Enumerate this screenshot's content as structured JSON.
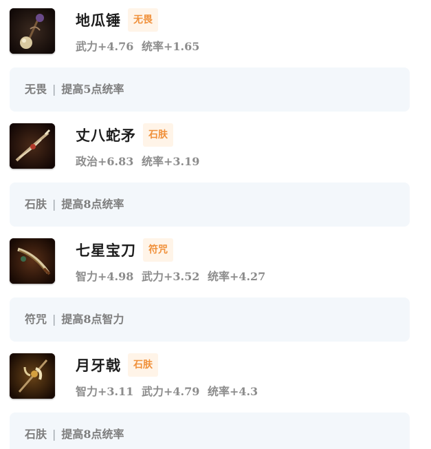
{
  "items": [
    {
      "name": "地瓜锤",
      "tag": "无畏",
      "stats": [
        "武力+4.76",
        "统率+1.65"
      ],
      "effect": {
        "tag": "无畏",
        "separator": "|",
        "desc": "提高5点统率"
      },
      "icon": "hammer-icon"
    },
    {
      "name": "丈八蛇矛",
      "tag": "石肤",
      "stats": [
        "政治+6.83",
        "统率+3.19"
      ],
      "effect": {
        "tag": "石肤",
        "separator": "|",
        "desc": "提高8点统率"
      },
      "icon": "spear-icon"
    },
    {
      "name": "七星宝刀",
      "tag": "符咒",
      "stats": [
        "智力+4.98",
        "武力+3.52",
        "统率+4.27"
      ],
      "effect": {
        "tag": "符咒",
        "separator": "|",
        "desc": "提高8点智力"
      },
      "icon": "saber-icon"
    },
    {
      "name": "月牙戟",
      "tag": "石肤",
      "stats": [
        "智力+3.11",
        "武力+4.79",
        "统率+4.3"
      ],
      "effect": {
        "tag": "石肤",
        "separator": "|",
        "desc": "提高8点统率"
      },
      "icon": "halberd-icon"
    }
  ],
  "colors": {
    "tag_text": "#f0903a",
    "tag_bg": "#fff4e8",
    "effect_bg": "#f3f7fb",
    "stat_text": "#8c8c8c"
  }
}
